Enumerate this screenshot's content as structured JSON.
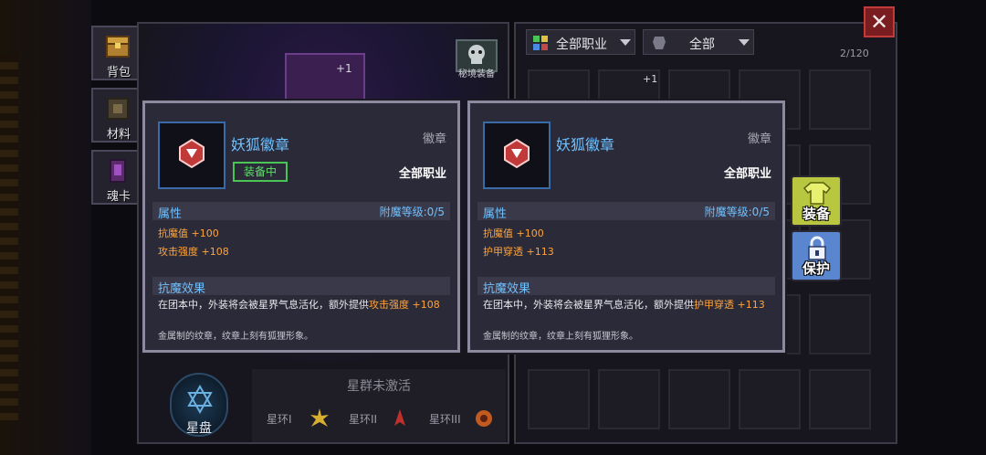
{
  "tabs": [
    {
      "label": "背包",
      "icon": "chest-icon"
    },
    {
      "label": "材料",
      "icon": "material-icon"
    },
    {
      "label": "魂卡",
      "icon": "soul-card-icon"
    }
  ],
  "left_panel": {
    "char_level": "+1",
    "secret_equip_label": "秘境装备",
    "constellation_status": "星群未激活",
    "star_disk_label": "星盘",
    "rings": [
      {
        "label": "星环I",
        "icon": "star-ring-1-icon",
        "color": "#d8b030"
      },
      {
        "label": "星环II",
        "icon": "star-ring-2-icon",
        "color": "#c0302a"
      },
      {
        "label": "星环III",
        "icon": "star-ring-3-icon",
        "color": "#c05a20"
      }
    ]
  },
  "right_panel": {
    "filter_class": "全部职业",
    "filter_type": "全部",
    "count": "2/120",
    "slot_plus": "+1"
  },
  "actions": {
    "equip": "装备",
    "protect": "保护"
  },
  "cards": [
    {
      "name": "妖狐徽章",
      "type": "徽章",
      "class": "全部职业",
      "equipped": "装备中",
      "attr_title": "属性",
      "enchant": "附魔等级:0/5",
      "stats": [
        "抗魔值 +100",
        "攻击强度 +108"
      ],
      "effect_title": "抗魔效果",
      "effect_text": "在团本中，外装将会被星界气息活化，额外提供",
      "effect_highlight": "攻击强度 +108",
      "flavor": "金属制的纹章，纹章上刻有狐狸形象。"
    },
    {
      "name": "妖狐徽章",
      "type": "徽章",
      "class": "全部职业",
      "equipped": "",
      "attr_title": "属性",
      "enchant": "附魔等级:0/5",
      "stats": [
        "抗魔值 +100",
        "护甲穿透 +113"
      ],
      "effect_title": "抗魔效果",
      "effect_text": "在团本中，外装将会被星界气息活化，额外提供",
      "effect_highlight": "护甲穿透 +113",
      "flavor": "金属制的纹章，纹章上刻有狐狸形象。"
    }
  ],
  "colors": {
    "rarity_blue": "#6ec0ff",
    "stat_orange": "#ffa43a",
    "equipped_green": "#5ee06a",
    "close_red": "#7a1d20"
  }
}
